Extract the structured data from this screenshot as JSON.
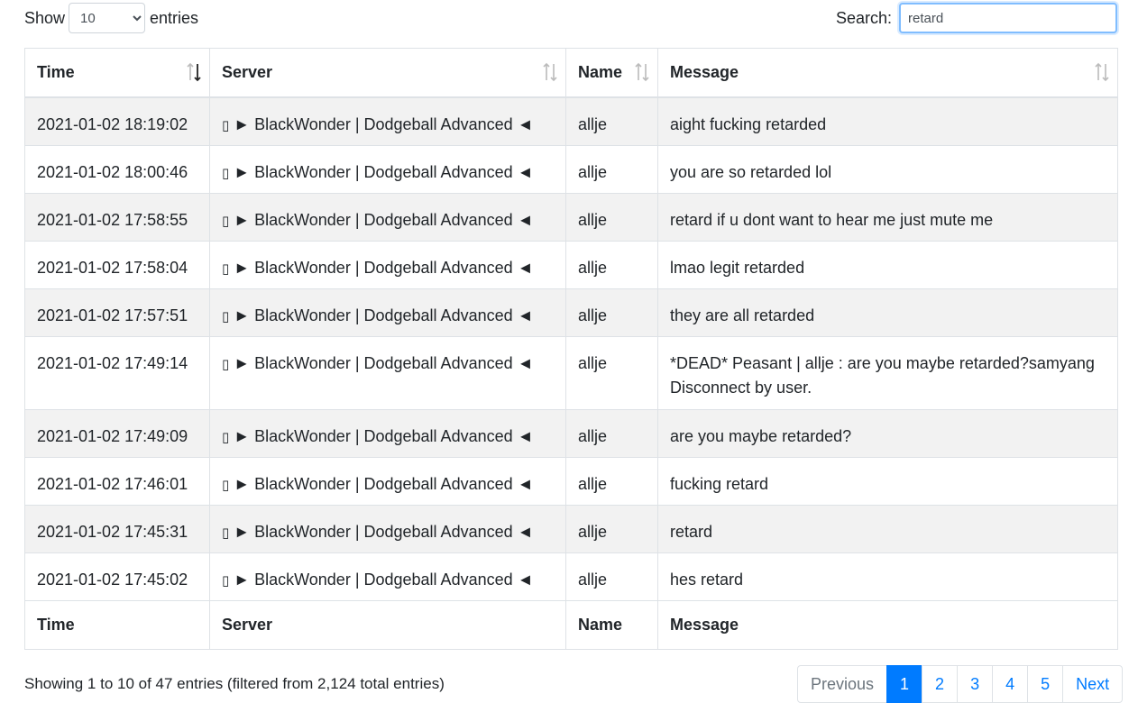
{
  "controls": {
    "show_label": "Show",
    "entries_label": "entries",
    "length_selected": "10",
    "search_label": "Search:",
    "search_value": "retard"
  },
  "columns": [
    "Time",
    "Server",
    "Name",
    "Message"
  ],
  "sort_icon": "sort-arrows-icon",
  "rows": [
    {
      "time": "2021-01-02 18:19:02",
      "server": "► BlackWonder | Dodgeball Advanced ◄",
      "name": "allje",
      "message": "aight fucking retarded"
    },
    {
      "time": "2021-01-02 18:00:46",
      "server": "► BlackWonder | Dodgeball Advanced ◄",
      "name": "allje",
      "message": "you are so retarded lol"
    },
    {
      "time": "2021-01-02 17:58:55",
      "server": "► BlackWonder | Dodgeball Advanced ◄",
      "name": "allje",
      "message": "retard if u dont want to hear me just mute me"
    },
    {
      "time": "2021-01-02 17:58:04",
      "server": "► BlackWonder | Dodgeball Advanced ◄",
      "name": "allje",
      "message": "lmao legit retarded"
    },
    {
      "time": "2021-01-02 17:57:51",
      "server": "► BlackWonder | Dodgeball Advanced ◄",
      "name": "allje",
      "message": "they are all retarded"
    },
    {
      "time": "2021-01-02 17:49:14",
      "server": "► BlackWonder | Dodgeball Advanced ◄",
      "name": "allje",
      "message": "*DEAD* Peasant | allje : are you maybe retarded?samyang Disconnect by user."
    },
    {
      "time": "2021-01-02 17:49:09",
      "server": "► BlackWonder | Dodgeball Advanced ◄",
      "name": "allje",
      "message": "are you maybe retarded?"
    },
    {
      "time": "2021-01-02 17:46:01",
      "server": "► BlackWonder | Dodgeball Advanced ◄",
      "name": "allje",
      "message": "fucking retard"
    },
    {
      "time": "2021-01-02 17:45:31",
      "server": "► BlackWonder | Dodgeball Advanced ◄",
      "name": "allje",
      "message": "retard"
    },
    {
      "time": "2021-01-02 17:45:02",
      "server": "► BlackWonder | Dodgeball Advanced ◄",
      "name": "allje",
      "message": "hes retard"
    }
  ],
  "server_prefix_glyph": "▯",
  "info_text": "Showing 1 to 10 of 47 entries (filtered from 2,124 total entries)",
  "pagination": {
    "previous": "Previous",
    "pages": [
      "1",
      "2",
      "3",
      "4",
      "5"
    ],
    "active_page": "1",
    "next": "Next"
  },
  "colors": {
    "accent": "#007bff",
    "stripe": "#f2f2f2",
    "border": "#dee2e6"
  }
}
